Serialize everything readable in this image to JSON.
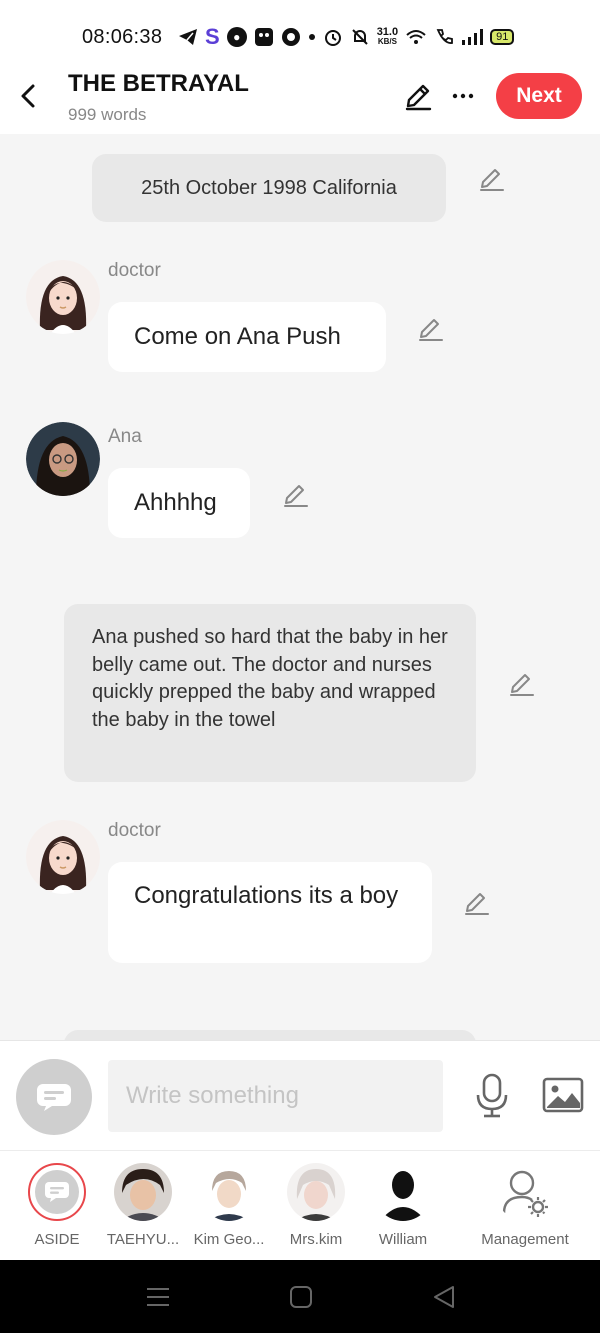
{
  "status_bar": {
    "time": "08:06:38",
    "net_speed_value": "31.0",
    "net_speed_unit": "KB/S",
    "battery": "91"
  },
  "header": {
    "title": "THE BETRAYAL",
    "word_count": "999 words",
    "next_label": "Next"
  },
  "messages": {
    "aside_1": "25th October 1998 California",
    "msg_1_speaker": "doctor",
    "msg_1_text": "Come on Ana Push",
    "msg_2_speaker": "Ana",
    "msg_2_text": "Ahhhhg",
    "aside_2": "Ana pushed so hard that the baby in her belly came out. The doctor and nurses quickly prepped the baby and wrapped the baby in the towel",
    "msg_3_speaker": "doctor",
    "msg_3_text": "Congratulations its a boy"
  },
  "composer": {
    "placeholder": "Write something",
    "value": ""
  },
  "characters": {
    "aside": "ASIDE",
    "c1": "TAEHYU...",
    "c2": "Kim Geo...",
    "c3": "Mrs.kim",
    "c4": "William",
    "management": "Management"
  },
  "colors": {
    "accent": "#f43f46",
    "aside_bubble": "#e8e8e8",
    "background": "#f5f5f5"
  }
}
